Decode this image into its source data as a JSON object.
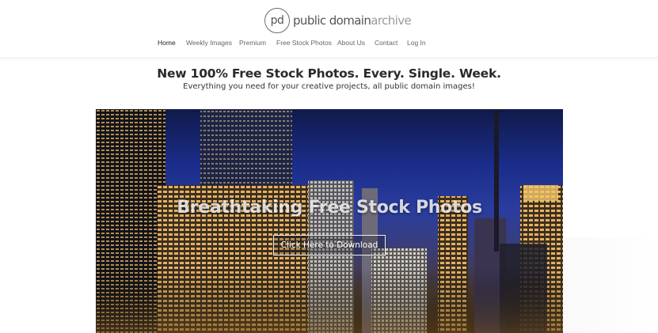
{
  "logo": {
    "mark": "pd",
    "name_bold": "public domain",
    "name_thin": "archive"
  },
  "nav": {
    "items": [
      {
        "label": "Home",
        "active": true
      },
      {
        "label": "Weekly Images"
      },
      {
        "label": "Premium"
      },
      {
        "label": "Free Stock Photos"
      },
      {
        "label": "About Us"
      },
      {
        "label": "Contact"
      },
      {
        "label": "Log In"
      }
    ]
  },
  "tagline": {
    "headline": "New 100% Free Stock Photos. Every. Single. Week.",
    "subhead": "Everything you need for your creative projects, all public domain images!"
  },
  "hero": {
    "title": "Breathtaking Free Stock Photos",
    "cta_label": "Click Here to Download",
    "image": "night-city-skyline"
  },
  "colors": {
    "sky": "#2a3d9e",
    "lights": "#f2c86a",
    "text": "#333333"
  }
}
